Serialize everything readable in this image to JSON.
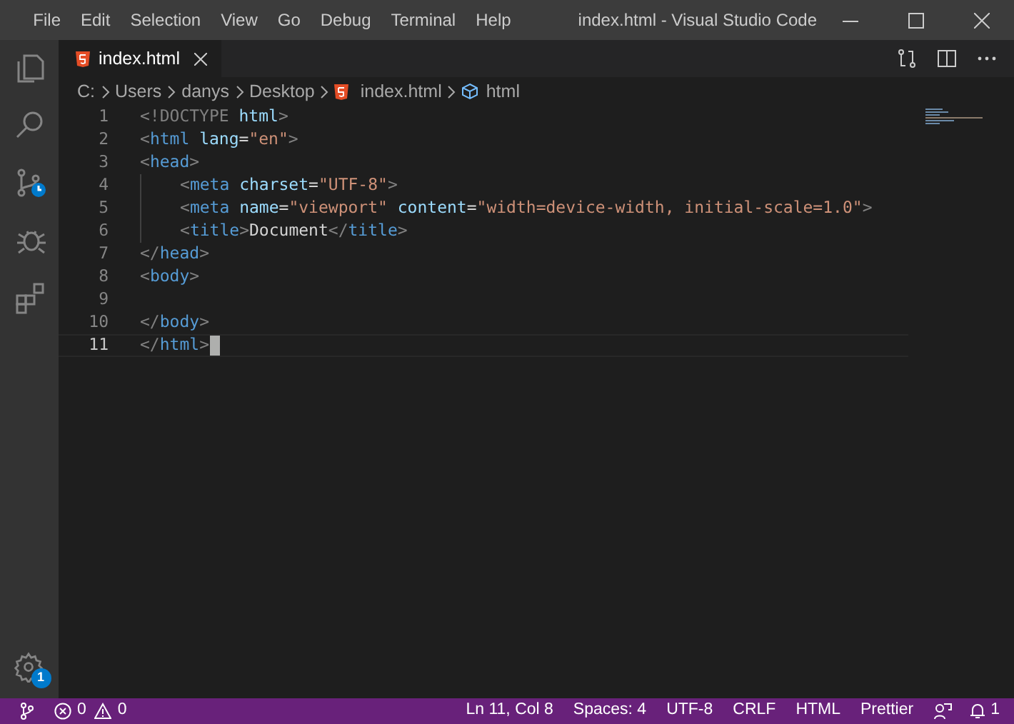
{
  "menu": [
    "File",
    "Edit",
    "Selection",
    "View",
    "Go",
    "Debug",
    "Terminal",
    "Help"
  ],
  "window": {
    "title": "index.html - Visual Studio Code"
  },
  "activity_bar": [
    {
      "kind": "files",
      "selected": false
    },
    {
      "kind": "search",
      "selected": false
    },
    {
      "kind": "source-control",
      "selected": false
    },
    {
      "kind": "debug",
      "selected": false
    },
    {
      "kind": "extensions",
      "selected": false
    }
  ],
  "settings_badge": "1",
  "tabs": [
    {
      "label": "index.html",
      "selected": true
    }
  ],
  "breadcrumb": [
    {
      "kind": "plain",
      "label": "C:"
    },
    {
      "kind": "plain",
      "label": "Users"
    },
    {
      "kind": "plain",
      "label": "danys"
    },
    {
      "kind": "plain",
      "label": "Desktop"
    },
    {
      "kind": "file",
      "label": "index.html"
    },
    {
      "kind": "element",
      "label": "html"
    }
  ],
  "editor": {
    "lines": [
      {
        "number": "1",
        "indented": false,
        "current": false,
        "tokens": [
          {
            "kind": "punct",
            "text": "<!DOCTYPE"
          },
          {
            "kind": "attr",
            "text": " html"
          },
          {
            "kind": "punct",
            "text": ">"
          }
        ]
      },
      {
        "number": "2",
        "indented": false,
        "current": false,
        "tokens": [
          {
            "kind": "punct",
            "text": "<"
          },
          {
            "kind": "tag",
            "text": "html"
          },
          {
            "kind": "attr",
            "text": " lang"
          },
          {
            "kind": "text",
            "text": "="
          },
          {
            "kind": "string",
            "text": "\"en\""
          },
          {
            "kind": "punct",
            "text": ">"
          }
        ]
      },
      {
        "number": "3",
        "indented": false,
        "current": false,
        "tokens": [
          {
            "kind": "punct",
            "text": "<"
          },
          {
            "kind": "tag",
            "text": "head"
          },
          {
            "kind": "punct",
            "text": ">"
          }
        ]
      },
      {
        "number": "4",
        "indented": true,
        "current": false,
        "tokens": [
          {
            "kind": "punct",
            "text": "<"
          },
          {
            "kind": "tag",
            "text": "meta"
          },
          {
            "kind": "attr",
            "text": " charset"
          },
          {
            "kind": "text",
            "text": "="
          },
          {
            "kind": "string",
            "text": "\"UTF-8\""
          },
          {
            "kind": "punct",
            "text": ">"
          }
        ]
      },
      {
        "number": "5",
        "indented": true,
        "current": false,
        "tokens": [
          {
            "kind": "punct",
            "text": "<"
          },
          {
            "kind": "tag",
            "text": "meta"
          },
          {
            "kind": "attr",
            "text": " name"
          },
          {
            "kind": "text",
            "text": "="
          },
          {
            "kind": "string",
            "text": "\"viewport\""
          },
          {
            "kind": "attr",
            "text": " content"
          },
          {
            "kind": "text",
            "text": "="
          },
          {
            "kind": "string",
            "text": "\"width=device-width, initial-scale=1.0\""
          },
          {
            "kind": "punct",
            "text": ">"
          }
        ]
      },
      {
        "number": "6",
        "indented": true,
        "current": false,
        "tokens": [
          {
            "kind": "punct",
            "text": "<"
          },
          {
            "kind": "tag",
            "text": "title"
          },
          {
            "kind": "punct",
            "text": ">"
          },
          {
            "kind": "text",
            "text": "Document"
          },
          {
            "kind": "punct",
            "text": "</"
          },
          {
            "kind": "tag",
            "text": "title"
          },
          {
            "kind": "punct",
            "text": ">"
          }
        ]
      },
      {
        "number": "7",
        "indented": false,
        "current": false,
        "tokens": [
          {
            "kind": "punct",
            "text": "</"
          },
          {
            "kind": "tag",
            "text": "head"
          },
          {
            "kind": "punct",
            "text": ">"
          }
        ]
      },
      {
        "number": "8",
        "indented": false,
        "current": false,
        "tokens": [
          {
            "kind": "punct",
            "text": "<"
          },
          {
            "kind": "tag",
            "text": "body"
          },
          {
            "kind": "punct",
            "text": ">"
          }
        ]
      },
      {
        "number": "9",
        "indented": false,
        "current": false
      },
      {
        "number": "10",
        "indented": false,
        "current": false,
        "tokens": [
          {
            "kind": "punct",
            "text": "</"
          },
          {
            "kind": "tag",
            "text": "body"
          },
          {
            "kind": "punct",
            "text": ">"
          }
        ]
      },
      {
        "number": "11",
        "indented": false,
        "current": true,
        "tokens": [
          {
            "kind": "punct",
            "text": "</"
          },
          {
            "kind": "tag",
            "text": "html"
          },
          {
            "kind": "punct",
            "text": ">"
          }
        ]
      }
    ]
  },
  "status_bar": {
    "problems": [
      {
        "kind": "error",
        "count": "0"
      },
      {
        "kind": "warning",
        "count": "0"
      }
    ],
    "items": [
      "Ln 11, Col 8",
      "Spaces: 4",
      "UTF-8",
      "CRLF",
      "HTML",
      "Prettier"
    ],
    "notifications": "1"
  }
}
